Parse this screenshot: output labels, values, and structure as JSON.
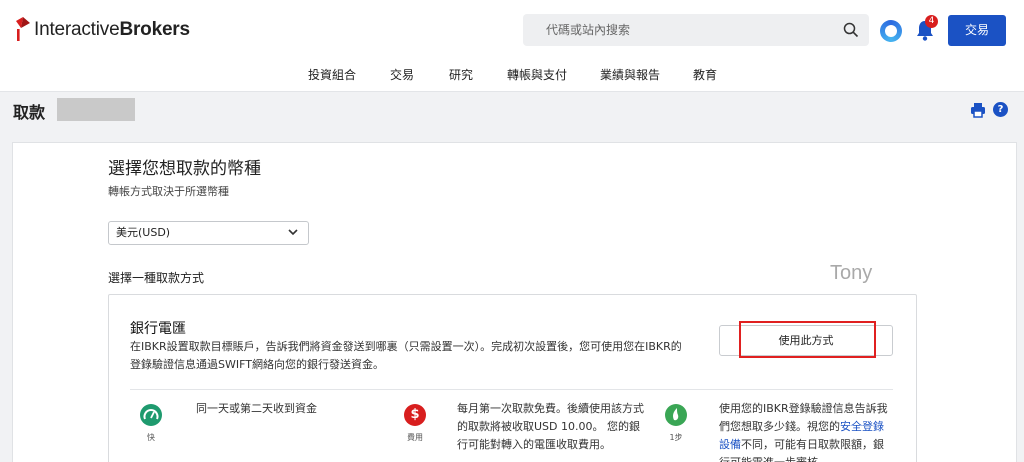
{
  "brand": {
    "prefix": "Interactive",
    "suffix": "Brokers",
    "color": "#d81e1e"
  },
  "search": {
    "placeholder": "代碼或站內搜索"
  },
  "header": {
    "notification_count": "4",
    "trade_label": "交易"
  },
  "nav": {
    "items": [
      "投資組合",
      "交易",
      "研究",
      "轉帳與支付",
      "業績與報告",
      "教育"
    ]
  },
  "page": {
    "title": "取款"
  },
  "currency": {
    "heading": "選擇您想取款的幣種",
    "subheading": "轉帳方式取決于所選幣種",
    "selected": "美元(USD)"
  },
  "methods": {
    "heading": "選擇一種取款方式",
    "watermark": "Tony",
    "wire": {
      "title": "銀行電匯",
      "description": "在IBKR設置取款目標賬戶，告訴我們將資金發送到哪裏（只需設置一次）。完成初次設置後，您可使用您在IBKR的登錄驗證信息通過SWIFT網絡向您的銀行發送資金。",
      "button": "使用此方式",
      "features": [
        {
          "icon": "speedometer-icon",
          "caption": "快",
          "text": "同一天或第二天收到資金"
        },
        {
          "icon": "dollar-icon",
          "caption": "費用",
          "text": "每月第一次取款免費。後續使用該方式的取款將被收取USD 10.00。 您的銀行可能對轉入的電匯收取費用。"
        },
        {
          "icon": "step-icon",
          "caption": "1步",
          "text_before": "使用您的IBKR登錄驗證信息告訴我們您想取多少錢。視您的",
          "link": "安全登錄設備",
          "text_after": "不同，可能有日取款限額，銀行可能需進一步審核。"
        }
      ]
    }
  },
  "colors": {
    "accent": "#1b52c4",
    "highlight": "#e02020",
    "fast": "#1e9a6e",
    "fee": "#d81e1e"
  }
}
